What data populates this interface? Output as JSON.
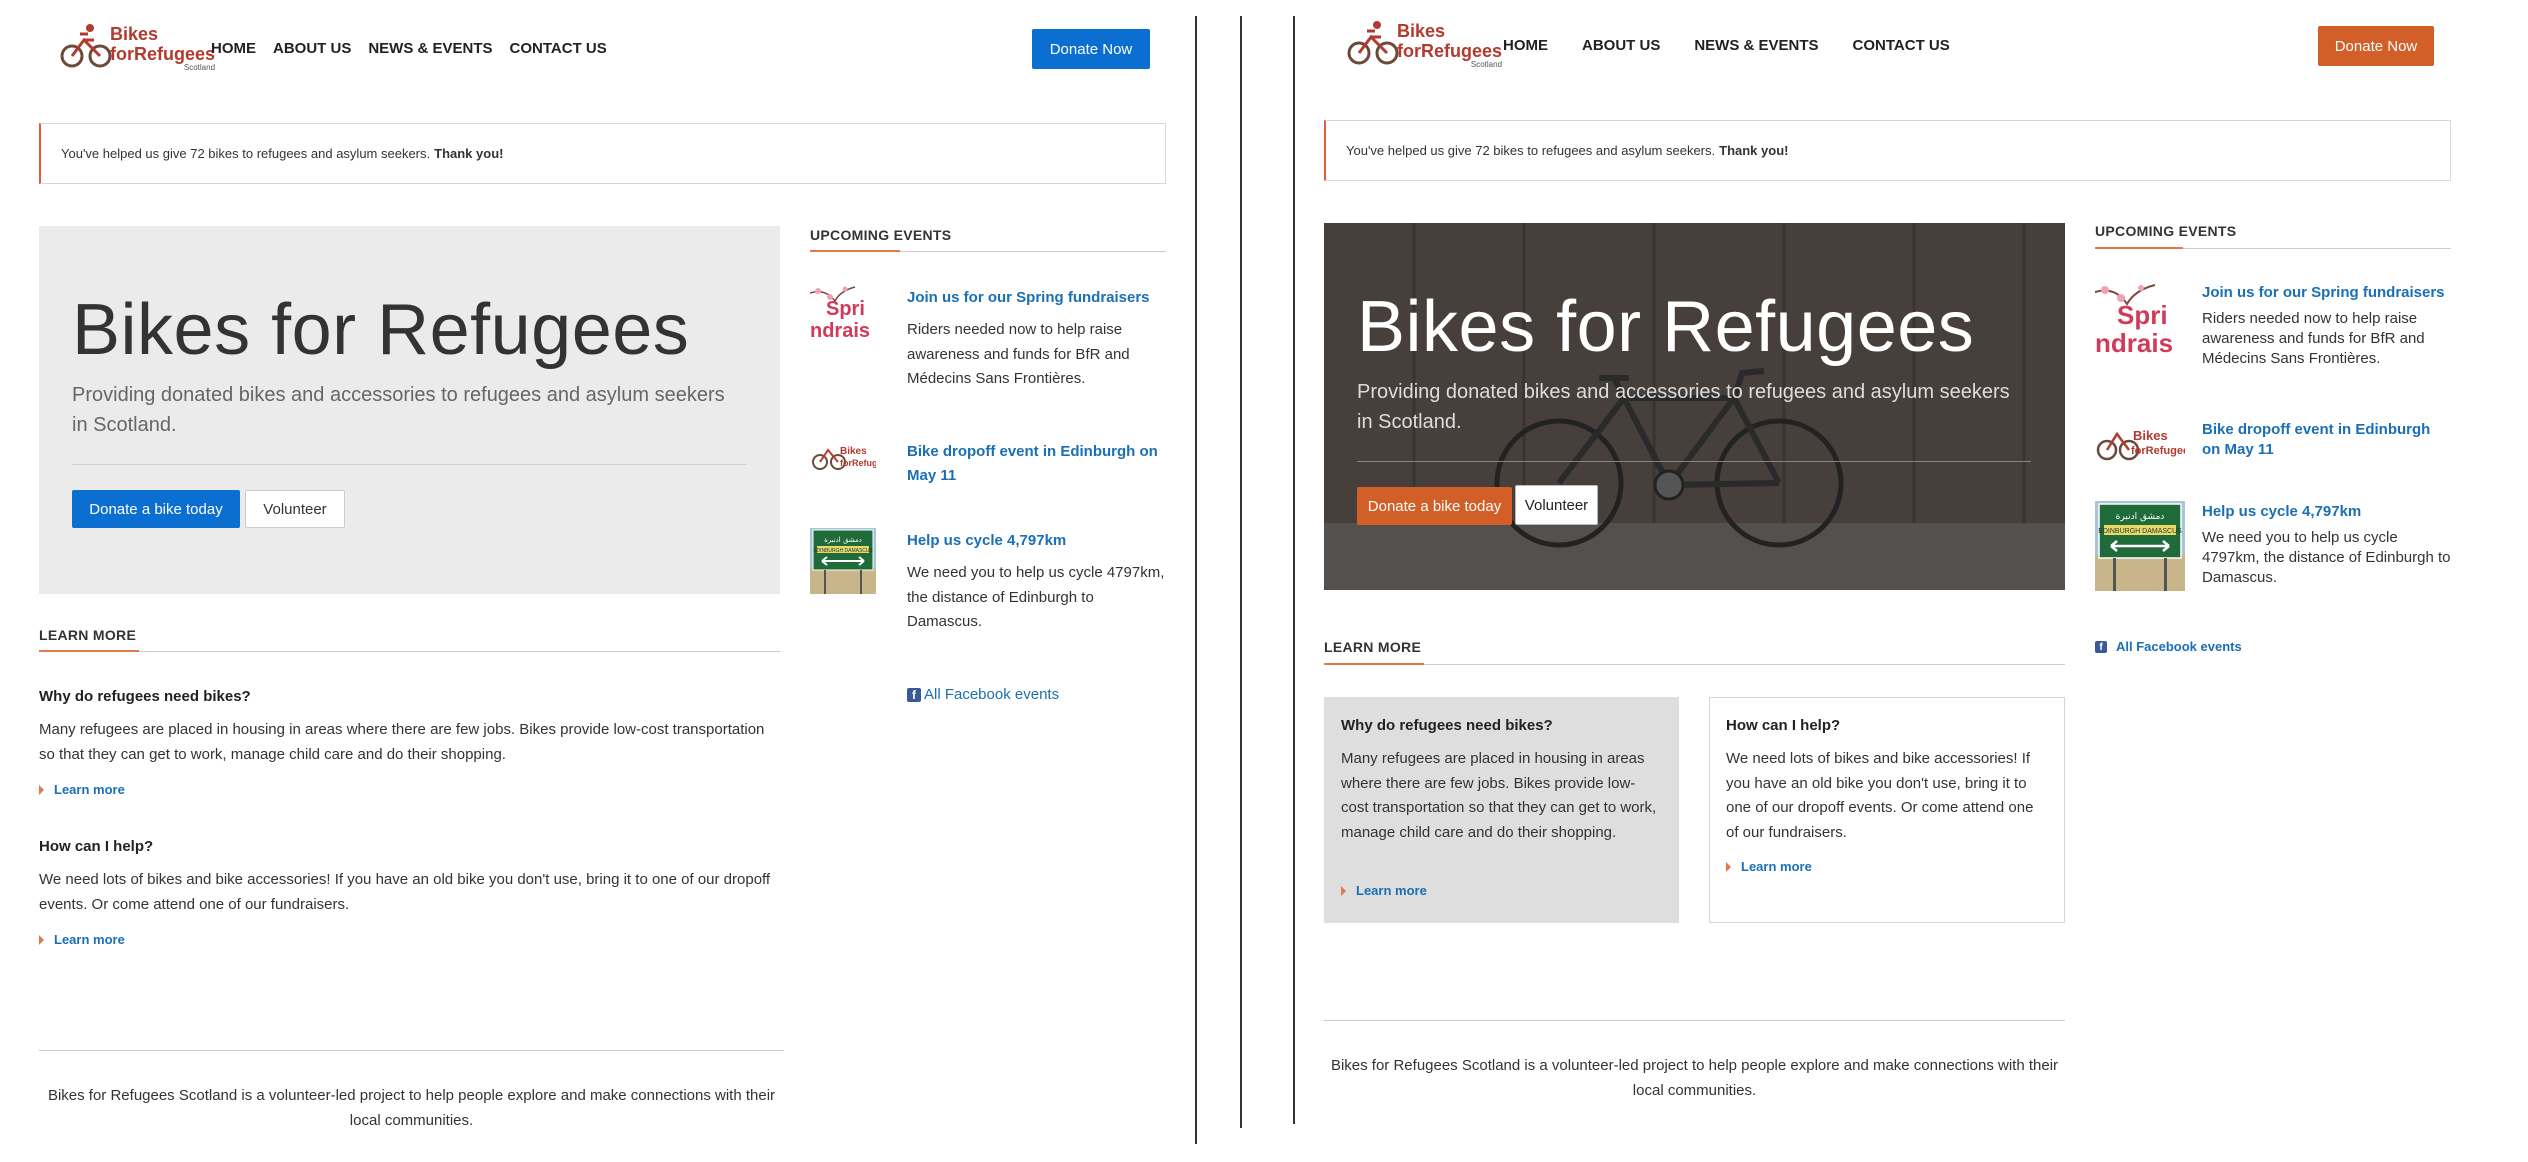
{
  "nav": {
    "home": "HOME",
    "about": "ABOUT US",
    "news": "NEWS & EVENTS",
    "contact": "CONTACT US"
  },
  "logo": {
    "line1": "Bikes",
    "line2": "forRefugees",
    "line3": "Scotland"
  },
  "header": {
    "donate_label": "Donate Now"
  },
  "notice": {
    "text": "You've helped us give 72 bikes to refugees and asylum seekers.",
    "thanks": "Thank you!"
  },
  "hero": {
    "title": "Bikes for Refugees",
    "subtitle": "Providing donated bikes and accessories to refugees and asylum seekers in Scotland.",
    "donate_bike_label": "Donate a bike today",
    "volunteer_label": "Volunteer"
  },
  "learn_more": {
    "heading": "LEARN MORE",
    "items": [
      {
        "title": "Why do refugees need bikes?",
        "body": "Many refugees are placed in housing in areas where there are few jobs. Bikes provide low-cost transportation so that they can get to work, manage child care and do their shopping.",
        "link": "Learn more"
      },
      {
        "title": "How can I help?",
        "body": "We need lots of bikes and bike accessories! If you have an old bike you don't use, bring it to one of our dropoff events. Or come attend one of our fundraisers.",
        "link": "Learn more"
      }
    ]
  },
  "events": {
    "heading": "UPCOMING EVENTS",
    "items": [
      {
        "title": "Join us for our Spring fundraisers",
        "body": "Riders needed now to help raise awareness and funds for BfR and Médecins Sans Frontières.",
        "thumb_text_1": "Spri",
        "thumb_text_2": "ndrais"
      },
      {
        "title": "Bike dropoff event in Edinburgh on May 11",
        "body": ""
      },
      {
        "title": "Help us cycle 4,797km",
        "body": "We need you to help us cycle 4797km, the distance of Edinburgh to Damascus.",
        "sign_top": "دمشق   ادنبرة",
        "sign_bottom": "EDINBURGH  DAMASCUS"
      }
    ],
    "facebook_link": "All Facebook events",
    "facebook_icon": "f"
  },
  "footer": {
    "text": "Bikes for Refugees Scotland is a volunteer-led project to help people explore and make connections with their local communities."
  },
  "colors": {
    "blue": "#0b6fd1",
    "orange": "#d35f28",
    "link": "#1a6fb5",
    "hero_grey": "#ebebeb"
  }
}
